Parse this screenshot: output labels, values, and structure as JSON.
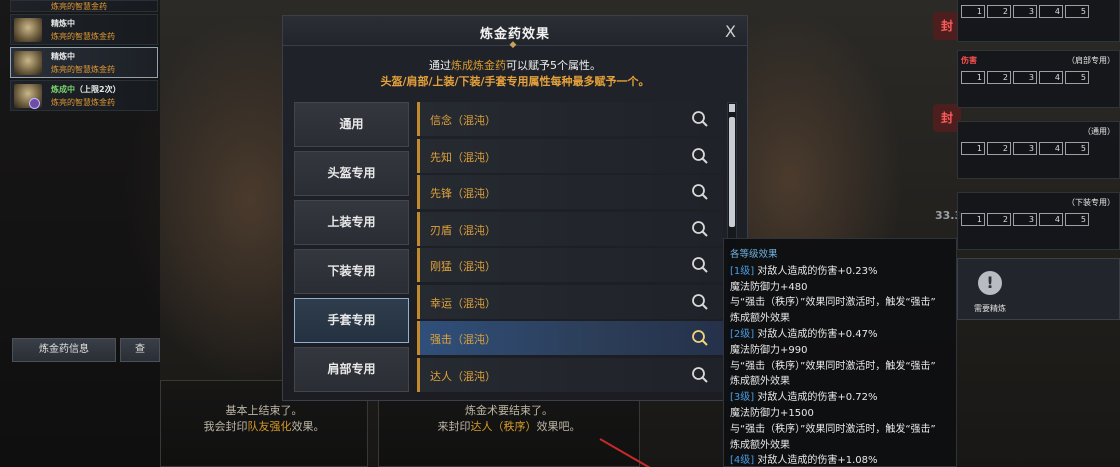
{
  "left_list": {
    "items": [
      {
        "status": "",
        "name": "炼亮的智慧金药",
        "partial": true
      },
      {
        "status": "精炼中",
        "name": "炼亮的智慧炼金药",
        "selected": false
      },
      {
        "status": "精炼中",
        "name": "炼亮的智慧炼金药",
        "selected": true
      },
      {
        "status": "炼成中",
        "status_suffix": "（上限2次）",
        "name": "炼亮的智慧炼金药",
        "selected": false
      }
    ],
    "info_button": "炼金药信息",
    "second_button": "查"
  },
  "dialogues": {
    "left": {
      "line1": "基本上结束了。",
      "line2_prefix": "我会封印",
      "line2_highlight": "队友强化",
      "line2_suffix": "效果。"
    },
    "middle": {
      "line1": "炼金术要结束了。",
      "line2_prefix": "来封印",
      "line2_highlight": "达人（秩序）",
      "line2_suffix": "效果吧。"
    }
  },
  "modal": {
    "title": "炼金药效果",
    "close": "X",
    "intro_line1_prefix": "通过",
    "intro_line1_highlight": "炼成炼金药",
    "intro_line1_suffix": "可以赋予5个属性。",
    "intro_line2": "头盔/肩部/上装/下装/手套专用属性每种最多赋予一个。",
    "tabs": [
      "通用",
      "头盔专用",
      "上装专用",
      "下装专用",
      "手套专用",
      "肩部专用"
    ],
    "selected_tab": 4,
    "rows": [
      {
        "label": "信念（混沌）",
        "selected": false
      },
      {
        "label": "先知（混沌）",
        "selected": false
      },
      {
        "label": "先锋（混沌）",
        "selected": false
      },
      {
        "label": "刃盾（混沌）",
        "selected": false
      },
      {
        "label": "刚猛（混沌）",
        "selected": false
      },
      {
        "label": "幸运（混沌）",
        "selected": false
      },
      {
        "label": "强击（混沌）",
        "selected": true
      },
      {
        "label": "达人（混沌）",
        "selected": false
      }
    ]
  },
  "tooltip": {
    "heading": "各等级效果",
    "lines": [
      {
        "level": "[1级]",
        "text": "对敌人造成的伤害+0.23%"
      },
      {
        "text": "魔法防御力+480"
      },
      {
        "text": "与“强击（秩序）”效果同时激活时，触发“强击”"
      },
      {
        "text": "炼成额外效果"
      },
      {
        "level": "[2级]",
        "text": "对敌人造成的伤害+0.47%"
      },
      {
        "text": "魔法防御力+990"
      },
      {
        "text": "与“强击（秩序）”效果同时激活时，触发“强击”"
      },
      {
        "text": "炼成额外效果"
      },
      {
        "level": "[3级]",
        "text": "对敌人造成的伤害+0.72%"
      },
      {
        "text": "魔法防御力+1500"
      },
      {
        "text": "与“强击（秩序）”效果同时激活时，触发“强击”"
      },
      {
        "text": "炼成额外效果"
      },
      {
        "level": "[4级]",
        "text": "对敌人造成的伤害+1.08%"
      }
    ]
  },
  "right_panel": {
    "groups": [
      {
        "title": "",
        "tag": "",
        "slots": [
          "1",
          "2",
          "3",
          "4",
          "5"
        ]
      },
      {
        "title": "伤害",
        "tag": "（肩部专用）",
        "slots": [
          "1",
          "2",
          "3",
          "4",
          "5"
        ]
      },
      {
        "title": "",
        "tag": "（通用）",
        "slots": [
          "1",
          "2",
          "3",
          "4",
          "5"
        ]
      },
      {
        "title": "",
        "tag": "（下装专用）",
        "slots": [
          "1",
          "2",
          "3",
          "4",
          "5"
        ]
      }
    ],
    "seal_tabs": [
      "封",
      "封"
    ],
    "need_refine": "需要精炼",
    "side_number": "33.3"
  },
  "colors": {
    "accent_gold": "#d99b2e",
    "selected_blue": "#2f4f7a",
    "level_blue": "#4b9be0"
  }
}
